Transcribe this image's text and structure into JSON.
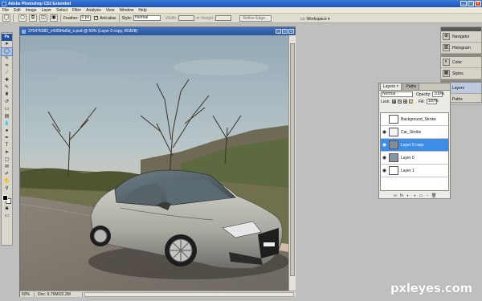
{
  "app": {
    "title": "Adobe Photoshop CS3 Extended",
    "window_buttons": [
      "_",
      "□",
      "x"
    ]
  },
  "menu": [
    "File",
    "Edit",
    "Image",
    "Layer",
    "Select",
    "Filter",
    "Analysis",
    "View",
    "Window",
    "Help"
  ],
  "options_bar": {
    "feather_label": "Feather:",
    "feather_value": "0 px",
    "antialias_label": "Anti-alias",
    "style_label": "Style:",
    "style_value": "Normal",
    "width_label": "Width:",
    "height_label": "Height:",
    "refine_edge_label": "Refine Edge...",
    "workspace_label": "Workspace ▾"
  },
  "toolbox": {
    "logo": "Ps",
    "tools": [
      {
        "name": "move-tool",
        "glyph": "➤"
      },
      {
        "name": "lasso-tool",
        "glyph": "◯",
        "active": true
      },
      {
        "name": "quick-select-tool",
        "glyph": "✎"
      },
      {
        "name": "crop-tool",
        "glyph": "⌗"
      },
      {
        "name": "slice-tool",
        "glyph": "⟋"
      },
      {
        "name": "healing-brush-tool",
        "glyph": "✚"
      },
      {
        "name": "brush-tool",
        "glyph": "✎"
      },
      {
        "name": "clone-stamp-tool",
        "glyph": "♜"
      },
      {
        "name": "history-brush-tool",
        "glyph": "↺"
      },
      {
        "name": "eraser-tool",
        "glyph": "▭"
      },
      {
        "name": "gradient-tool",
        "glyph": "▤"
      },
      {
        "name": "blur-tool",
        "glyph": "💧"
      },
      {
        "name": "dodge-tool",
        "glyph": "●"
      },
      {
        "name": "pen-tool",
        "glyph": "✒"
      },
      {
        "name": "type-tool",
        "glyph": "T"
      },
      {
        "name": "path-select-tool",
        "glyph": "➤"
      },
      {
        "name": "shape-tool",
        "glyph": "▢"
      },
      {
        "name": "notes-tool",
        "glyph": "✉"
      },
      {
        "name": "eyedropper-tool",
        "glyph": "✐"
      },
      {
        "name": "hand-tool",
        "glyph": "✋"
      },
      {
        "name": "zoom-tool",
        "glyph": "⚲"
      }
    ],
    "foreground_color": "#000000",
    "background_color": "#ffffff"
  },
  "document": {
    "title": "375476382_c43594a5d_o.psd @ 50% (Layer 0 copy, RGB/8)",
    "zoom": "50%",
    "doc_size": "Doc: 9.76M/22.2M"
  },
  "dock": {
    "items": [
      {
        "label": "Navigator",
        "glyph": "⊕"
      },
      {
        "label": "Histogram",
        "glyph": "▥"
      },
      {
        "label": "Color",
        "glyph": "◐"
      },
      {
        "label": "Styles",
        "glyph": "▦"
      },
      {
        "label": "Layers",
        "glyph": "◈",
        "selected": true
      },
      {
        "label": "Paths",
        "glyph": "⌁"
      }
    ]
  },
  "layers_panel": {
    "tabs": [
      "Layers ×",
      "Paths"
    ],
    "blend_mode": "Normal",
    "opacity_label": "Opacity:",
    "opacity_value": "100%",
    "lock_label": "Lock:",
    "fill_label": "Fill:",
    "fill_value": "100%",
    "layers": [
      {
        "name": "Background_Stroke",
        "visible": false,
        "selected": false,
        "thumb": "#ffffff"
      },
      {
        "name": "Car_Stroke",
        "visible": true,
        "selected": false,
        "thumb": "#f4f4f4"
      },
      {
        "name": "Layer 0 copy",
        "visible": true,
        "selected": true,
        "thumb": "#7f8d9a"
      },
      {
        "name": "Layer 0",
        "visible": true,
        "selected": false,
        "thumb": "#8595a4"
      },
      {
        "name": "Layer 1",
        "visible": true,
        "selected": false,
        "thumb": "#ffffff"
      }
    ],
    "footer_icons": [
      "∞",
      "fx",
      "◐",
      "◑",
      "▭",
      "▫",
      "🗑"
    ]
  },
  "watermark": "pxleyes.com"
}
